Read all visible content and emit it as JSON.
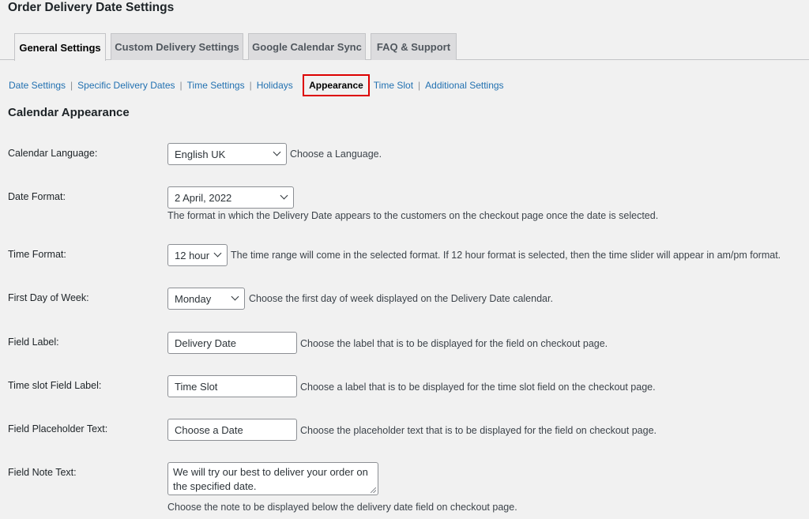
{
  "page_title": "Order Delivery Date Settings",
  "tabs": [
    {
      "label": "General Settings",
      "active": true
    },
    {
      "label": "Custom Delivery Settings",
      "active": false
    },
    {
      "label": "Google Calendar Sync",
      "active": false
    },
    {
      "label": "FAQ & Support",
      "active": false
    }
  ],
  "subnav": {
    "items": [
      "Date Settings",
      "Specific Delivery Dates",
      "Time Settings",
      "Holidays",
      "Appearance",
      "Time Slot",
      "Additional Settings"
    ],
    "current": "Appearance",
    "highlight_color": "#dd0000"
  },
  "section_title": "Calendar Appearance",
  "fields": {
    "calendar_language": {
      "label": "Calendar Language:",
      "value": "English UK",
      "description": "Choose a Language."
    },
    "date_format": {
      "label": "Date Format:",
      "value": "2 April, 2022",
      "description": "The format in which the Delivery Date appears to the customers on the checkout page once the date is selected."
    },
    "time_format": {
      "label": "Time Format:",
      "value": "12 hour",
      "description": "The time range will come in the selected format. If 12 hour format is selected, then the time slider will appear in am/pm format."
    },
    "first_day": {
      "label": "First Day of Week:",
      "value": "Monday",
      "description": "Choose the first day of week displayed on the Delivery Date calendar."
    },
    "field_label": {
      "label": "Field Label:",
      "value": "Delivery Date",
      "description": "Choose the label that is to be displayed for the field on checkout page."
    },
    "time_slot_label": {
      "label": "Time slot Field Label:",
      "value": "Time Slot",
      "description": "Choose a label that is to be displayed for the time slot field on the checkout page."
    },
    "placeholder": {
      "label": "Field Placeholder Text:",
      "value": "Choose a Date",
      "description": "Choose the placeholder text that is to be displayed for the field on checkout page."
    },
    "note_text": {
      "label": "Field Note Text:",
      "value": "We will try our best to deliver your order on the specified date.",
      "description": "Choose the note to be displayed below the delivery date field on checkout page."
    }
  },
  "colors": {
    "link": "#2271b1",
    "background": "#f1f1f1",
    "tab_inactive": "#dcdcde"
  }
}
